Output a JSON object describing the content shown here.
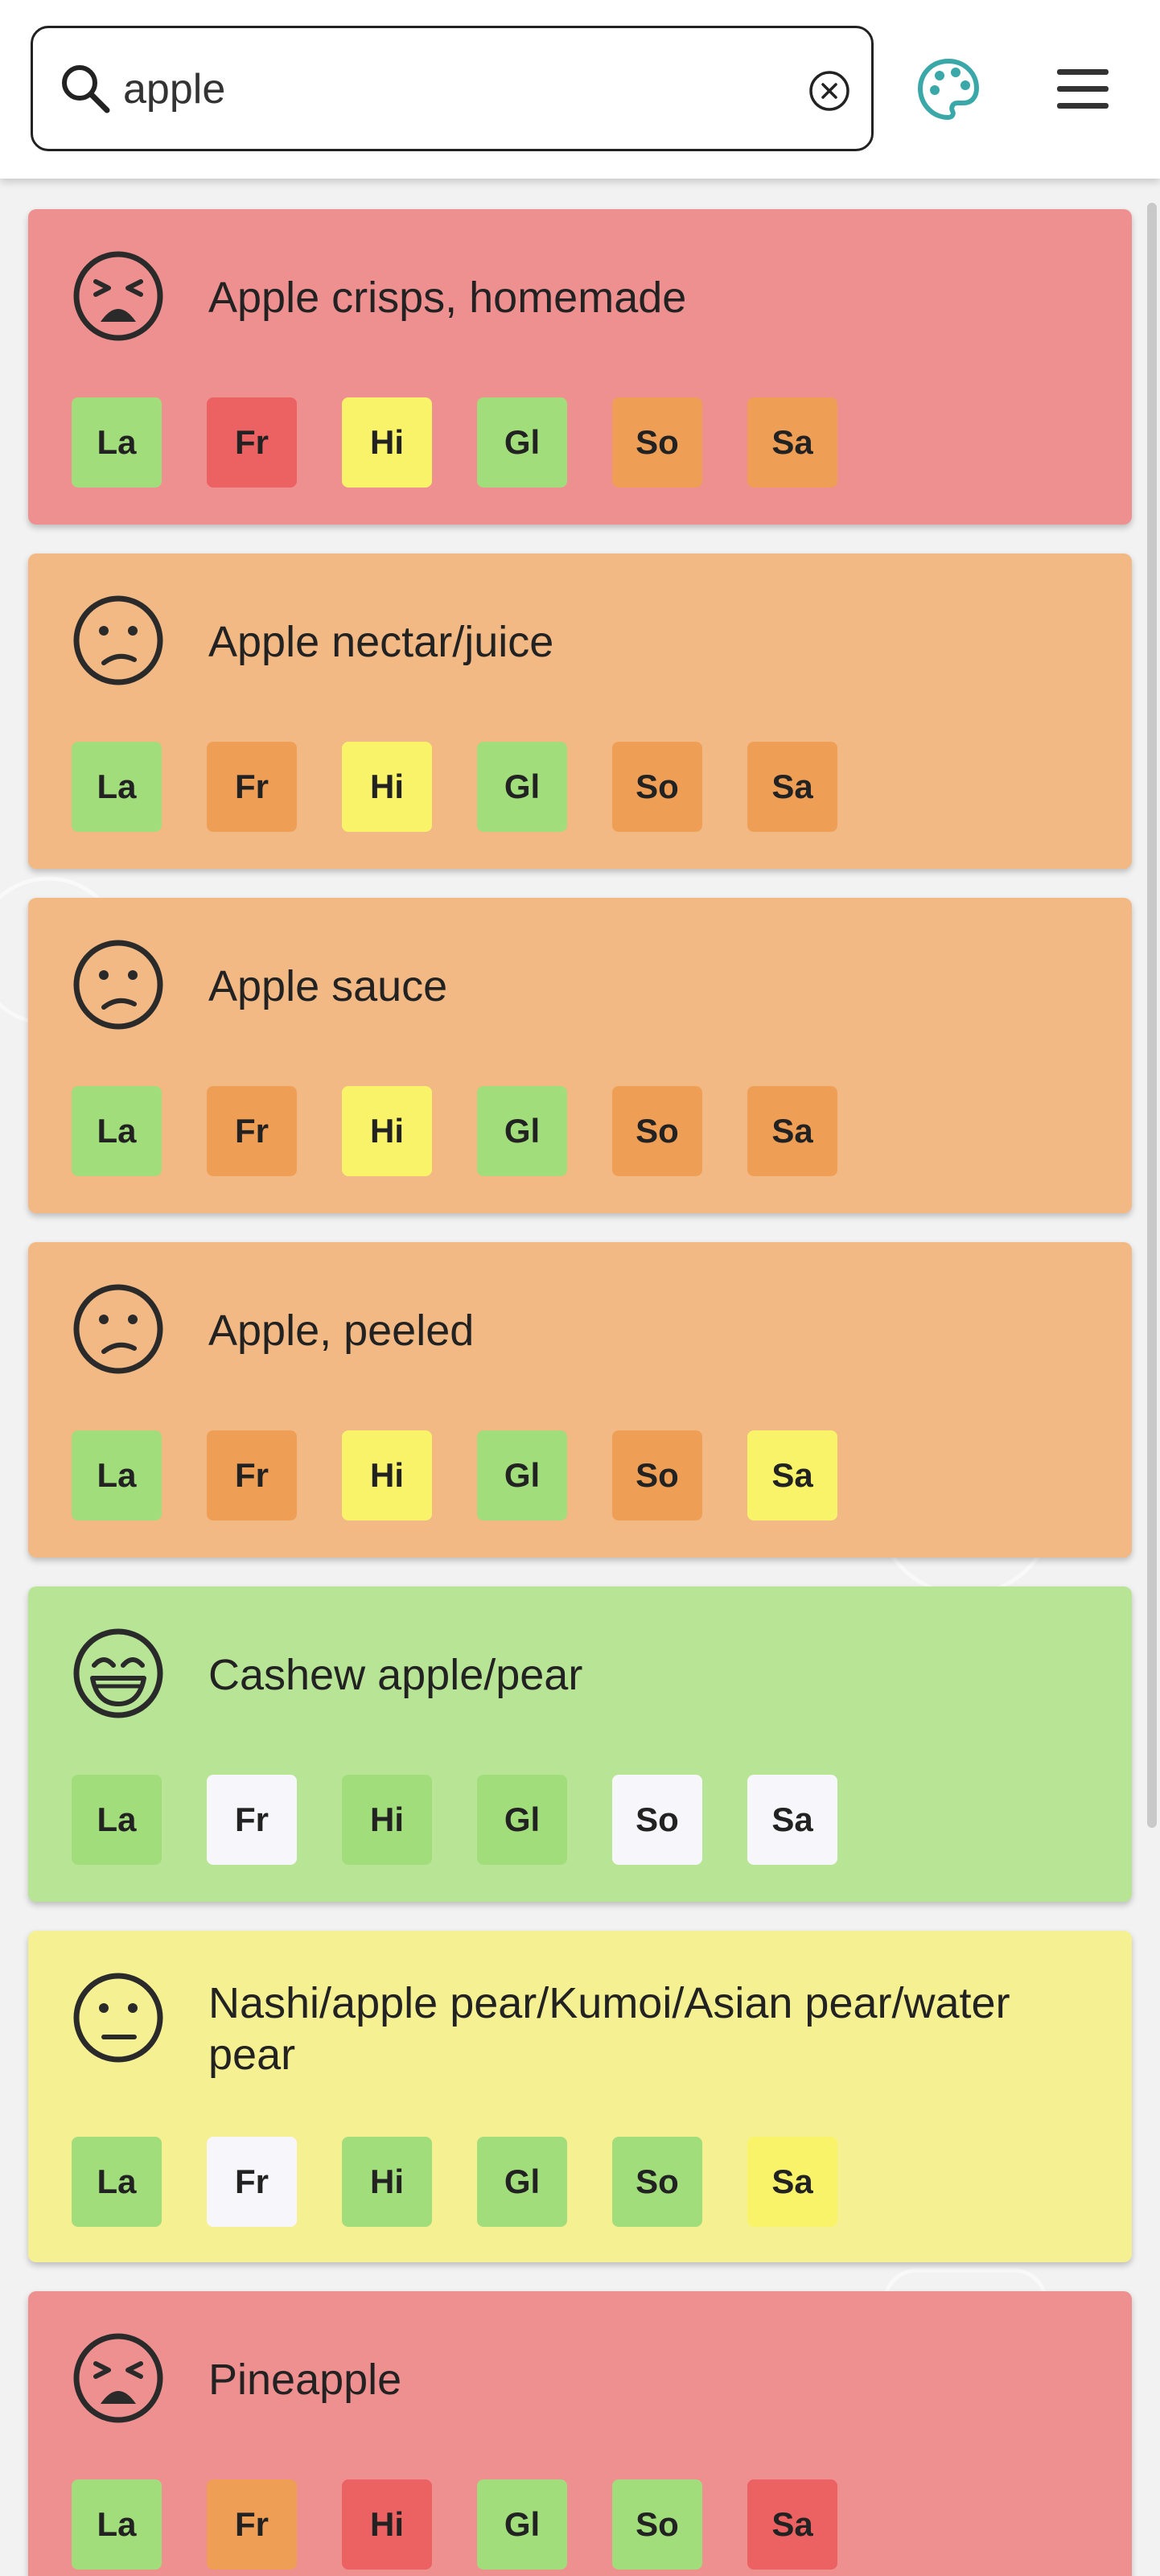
{
  "search": {
    "value": "apple",
    "icon": "search-icon",
    "clear_icon": "clear-icon"
  },
  "header": {
    "palette_icon": "palette-icon",
    "menu_icon": "hamburger-menu-icon"
  },
  "colors": {
    "red_card": "#ef9090",
    "orange_card": "#f2b984",
    "green_card": "#b8e496",
    "yellow_card": "#f5f192",
    "tag_green": "#a2dd7c",
    "tag_red": "#ec6262",
    "tag_orange": "#ef9f55",
    "tag_yellow": "#f9f36a",
    "tag_white": "#f7f7fb",
    "palette_teal": "#3aa8a8"
  },
  "foods": [
    {
      "name": "Apple crisps, homemade",
      "rating": "red",
      "face": "tired-face-icon",
      "tags": [
        {
          "label": "La",
          "level": "green"
        },
        {
          "label": "Fr",
          "level": "red"
        },
        {
          "label": "Hi",
          "level": "yellow"
        },
        {
          "label": "Gl",
          "level": "green"
        },
        {
          "label": "So",
          "level": "orange"
        },
        {
          "label": "Sa",
          "level": "orange"
        }
      ]
    },
    {
      "name": "Apple nectar/juice",
      "rating": "orange",
      "face": "confused-face-icon",
      "tags": [
        {
          "label": "La",
          "level": "green"
        },
        {
          "label": "Fr",
          "level": "orange"
        },
        {
          "label": "Hi",
          "level": "yellow"
        },
        {
          "label": "Gl",
          "level": "green"
        },
        {
          "label": "So",
          "level": "orange"
        },
        {
          "label": "Sa",
          "level": "orange"
        }
      ]
    },
    {
      "name": "Apple sauce",
      "rating": "orange",
      "face": "confused-face-icon",
      "tags": [
        {
          "label": "La",
          "level": "green"
        },
        {
          "label": "Fr",
          "level": "orange"
        },
        {
          "label": "Hi",
          "level": "yellow"
        },
        {
          "label": "Gl",
          "level": "green"
        },
        {
          "label": "So",
          "level": "orange"
        },
        {
          "label": "Sa",
          "level": "orange"
        }
      ]
    },
    {
      "name": "Apple, peeled",
      "rating": "orange",
      "face": "confused-face-icon",
      "tags": [
        {
          "label": "La",
          "level": "green"
        },
        {
          "label": "Fr",
          "level": "orange"
        },
        {
          "label": "Hi",
          "level": "yellow"
        },
        {
          "label": "Gl",
          "level": "green"
        },
        {
          "label": "So",
          "level": "orange"
        },
        {
          "label": "Sa",
          "level": "yellow"
        }
      ]
    },
    {
      "name": "Cashew apple/pear",
      "rating": "green",
      "face": "grinning-face-icon",
      "tags": [
        {
          "label": "La",
          "level": "green"
        },
        {
          "label": "Fr",
          "level": "white"
        },
        {
          "label": "Hi",
          "level": "green"
        },
        {
          "label": "Gl",
          "level": "green"
        },
        {
          "label": "So",
          "level": "white"
        },
        {
          "label": "Sa",
          "level": "white"
        }
      ]
    },
    {
      "name": "Nashi/apple pear/Kumoi/Asian pear/water pear",
      "rating": "yellow",
      "face": "neutral-face-icon",
      "tags": [
        {
          "label": "La",
          "level": "green"
        },
        {
          "label": "Fr",
          "level": "white"
        },
        {
          "label": "Hi",
          "level": "green"
        },
        {
          "label": "Gl",
          "level": "green"
        },
        {
          "label": "So",
          "level": "green"
        },
        {
          "label": "Sa",
          "level": "yellow"
        }
      ]
    },
    {
      "name": "Pineapple",
      "rating": "red",
      "face": "tired-face-icon",
      "tags": [
        {
          "label": "La",
          "level": "green"
        },
        {
          "label": "Fr",
          "level": "orange"
        },
        {
          "label": "Hi",
          "level": "red"
        },
        {
          "label": "Gl",
          "level": "green"
        },
        {
          "label": "So",
          "level": "green"
        },
        {
          "label": "Sa",
          "level": "red"
        }
      ]
    }
  ]
}
